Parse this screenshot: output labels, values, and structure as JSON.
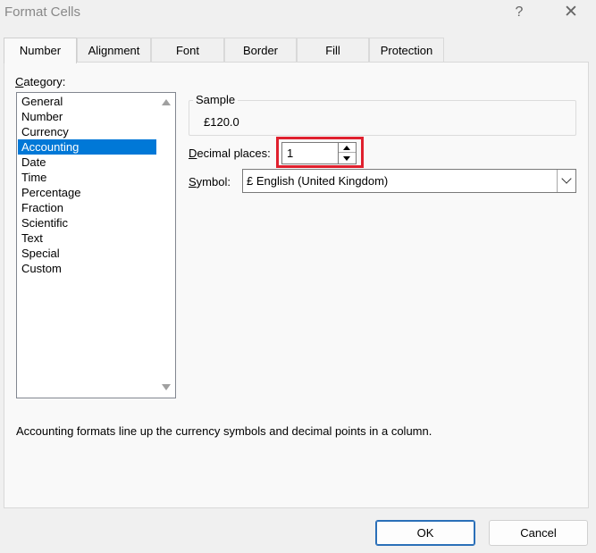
{
  "window": {
    "title": "Format Cells",
    "help": "?",
    "close": "✕"
  },
  "tabs": [
    {
      "label": "Number",
      "active": true
    },
    {
      "label": "Alignment"
    },
    {
      "label": "Font"
    },
    {
      "label": "Border"
    },
    {
      "label": "Fill"
    },
    {
      "label": "Protection"
    }
  ],
  "category": {
    "label_first": "C",
    "label_rest": "ategory:",
    "items": [
      "General",
      "Number",
      "Currency",
      "Accounting",
      "Date",
      "Time",
      "Percentage",
      "Fraction",
      "Scientific",
      "Text",
      "Special",
      "Custom"
    ],
    "selected": "Accounting"
  },
  "sample": {
    "legend": "Sample",
    "value": "£120.0"
  },
  "decimal_places": {
    "label_first": "D",
    "label_rest": "ecimal places:",
    "value": "1"
  },
  "symbol": {
    "label_first": "S",
    "label_rest": "ymbol:",
    "value": "£ English (United Kingdom)"
  },
  "description": "Accounting formats line up the currency symbols and decimal points in a column.",
  "buttons": {
    "ok": "OK",
    "cancel": "Cancel"
  },
  "colors": {
    "selection": "#0078d7",
    "highlight": "#e0202e",
    "ok_border": "#2a6fb8"
  }
}
